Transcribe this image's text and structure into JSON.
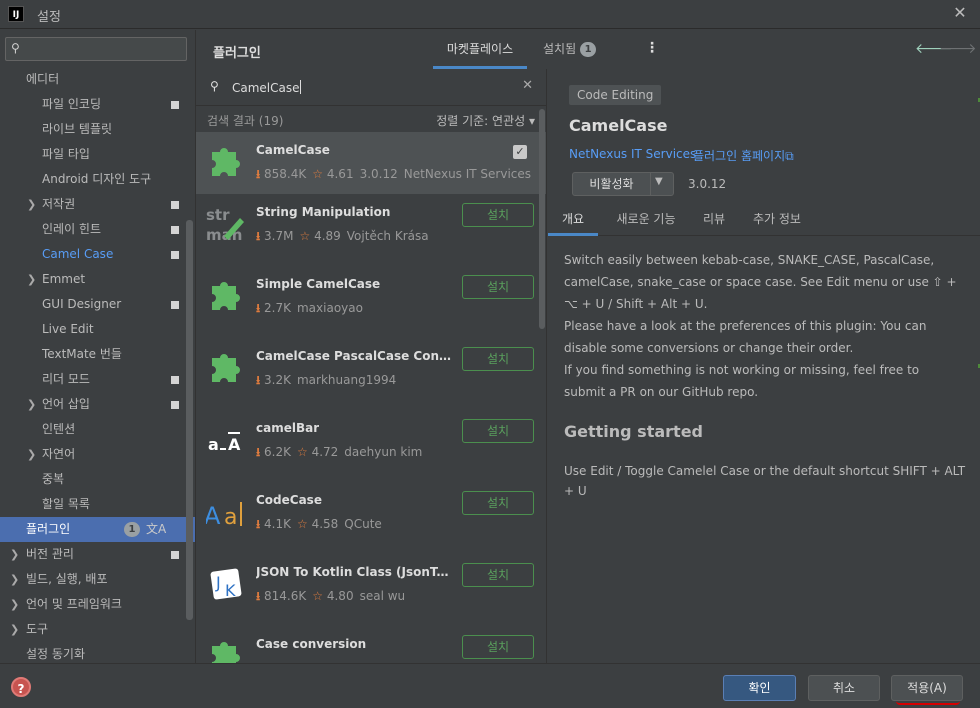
{
  "window": {
    "title": "설정",
    "app_icon_label": "IJ"
  },
  "sidebar": {
    "search_placeholder": "",
    "items": [
      {
        "label": "에디터",
        "level": 0
      },
      {
        "label": "파일 인코딩",
        "level": 1,
        "proj": true
      },
      {
        "label": "라이브 템플릿",
        "level": 1
      },
      {
        "label": "파일 타입",
        "level": 1
      },
      {
        "label": "Android 디자인 도구",
        "level": 1
      },
      {
        "label": "저작권",
        "level": 1,
        "arrow": true,
        "proj": true
      },
      {
        "label": "인레이 힌트",
        "level": 1,
        "proj": true
      },
      {
        "label": "Camel Case",
        "level": 1,
        "proj": true,
        "active": true
      },
      {
        "label": "Emmet",
        "level": 1,
        "arrow": true
      },
      {
        "label": "GUI Designer",
        "level": 1,
        "proj": true
      },
      {
        "label": "Live Edit",
        "level": 1
      },
      {
        "label": "TextMate 번들",
        "level": 1
      },
      {
        "label": "리더 모드",
        "level": 1,
        "proj": true
      },
      {
        "label": "언어 삽입",
        "level": 1,
        "arrow": true,
        "proj": true
      },
      {
        "label": "인텐션",
        "level": 1
      },
      {
        "label": "자연어",
        "level": 1,
        "arrow": true
      },
      {
        "label": "중복",
        "level": 1
      },
      {
        "label": "할일 목록",
        "level": 1
      },
      {
        "label": "플러그인",
        "level": 0,
        "selected": true,
        "badge": "1"
      },
      {
        "label": "버전 관리",
        "level": 0,
        "arrow": true,
        "proj": true
      },
      {
        "label": "빌드, 실행, 배포",
        "level": 0,
        "arrow": true
      },
      {
        "label": "언어 및 프레임워크",
        "level": 0,
        "arrow": true
      },
      {
        "label": "도구",
        "level": 0,
        "arrow": true
      },
      {
        "label": "설정 동기화",
        "level": 0
      }
    ]
  },
  "plugins_header": {
    "title": "플러그인",
    "tab_marketplace": "마켓플레이스",
    "tab_installed": "설치됨",
    "installed_count": "1"
  },
  "plugin_search": {
    "value": "CamelCase",
    "results": "검색 결과 (19)",
    "sort": "정렬 기준: 연관성"
  },
  "plugins": [
    {
      "name": "CamelCase",
      "downloads": "858.4K",
      "rating": "4.61",
      "version": "3.0.12",
      "vendor": "NetNexus IT Services",
      "installed": true,
      "icon": "puzzle"
    },
    {
      "name": "String Manipulation",
      "downloads": "3.7M",
      "rating": "4.89",
      "vendor": "Vojtěch Krása",
      "icon": "string-manip",
      "install_label": "설치"
    },
    {
      "name": "Simple CamelCase",
      "downloads": "2.7K",
      "vendor": "maxiaoyao",
      "icon": "puzzle",
      "install_label": "설치"
    },
    {
      "name": "CamelCase PascalCase Converter",
      "downloads": "3.2K",
      "vendor": "markhuang1994",
      "icon": "puzzle",
      "install_label": "설치"
    },
    {
      "name": "camelBar",
      "downloads": "6.2K",
      "rating": "4.72",
      "vendor": "daehyun kim",
      "icon": "camelbar",
      "install_label": "설치"
    },
    {
      "name": "CodeCase",
      "downloads": "4.1K",
      "rating": "4.58",
      "vendor": "QCute",
      "icon": "codecase",
      "install_label": "설치"
    },
    {
      "name": "JSON To Kotlin Class (JsonToKo...",
      "downloads": "814.6K",
      "rating": "4.80",
      "vendor": "seal wu",
      "icon": "json-kotlin",
      "install_label": "설치"
    },
    {
      "name": "Case conversion",
      "downloads": "",
      "vendor": "",
      "icon": "puzzle",
      "install_label": "설치"
    }
  ],
  "detail": {
    "category": "Code Editing",
    "name": "CamelCase",
    "vendor": "NetNexus IT Services",
    "homepage": "플러그인 홈페이지",
    "disable_label": "비활성화",
    "version": "3.0.12",
    "tabs": [
      "개요",
      "새로운 기능",
      "리뷰",
      "추가 정보"
    ],
    "description_1": "Switch easily between kebab-case, SNAKE_CASE, PascalCase, camelCase, snake_case or space case. See Edit menu or use ⇧ + ⌥ + U / Shift + Alt + U.",
    "description_2": "Please have a look at the preferences of this plugin: You can disable some conversions or change their order.",
    "description_3": "If you find something is not working or missing, feel free to submit a PR on our GitHub repo.",
    "heading": "Getting started",
    "usage": "Use Edit / Toggle Camelel Case or the default shortcut SHIFT + ALT + U"
  },
  "footer": {
    "ok": "확인",
    "cancel": "취소",
    "apply": "적용(A)"
  },
  "colors": {
    "accent": "#4a88c7",
    "selected": "#4b6eaf",
    "install_green": "#5aa05d",
    "download_orange": "#e07c3e",
    "link": "#589df6",
    "help_red": "#c75450",
    "annotation_red": "#d60000"
  }
}
